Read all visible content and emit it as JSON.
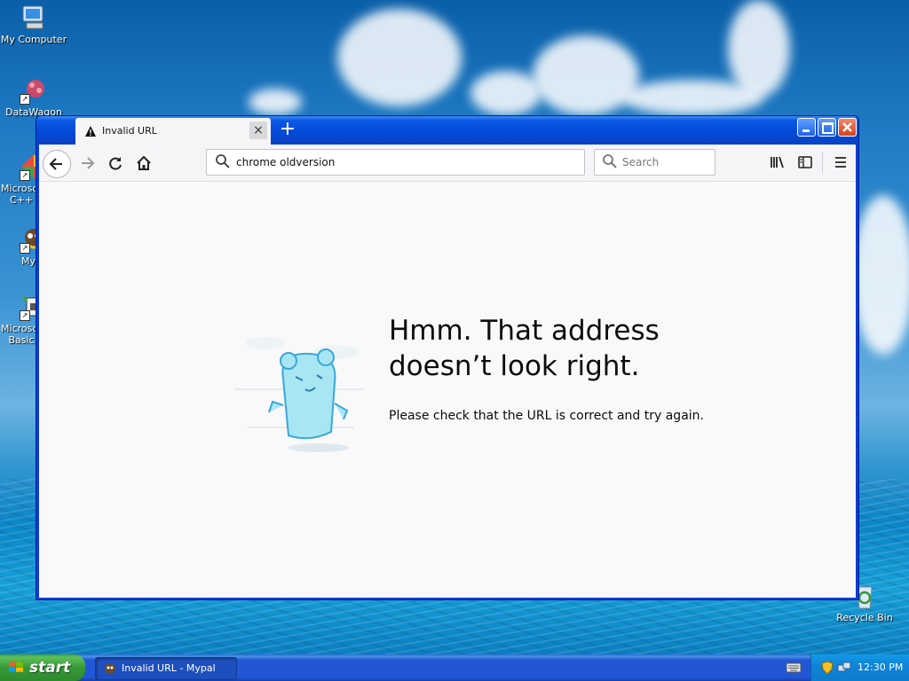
{
  "desktop": {
    "icons": [
      {
        "label": "My Computer"
      },
      {
        "label": "DataWagon"
      },
      {
        "label": "Microsof\nC++"
      },
      {
        "label": "My"
      },
      {
        "label": "Microsof\nBasic"
      },
      {
        "label": "Recycle Bin"
      }
    ]
  },
  "browser": {
    "tab": {
      "title": "Invalid URL",
      "close_glyph": "×"
    },
    "new_tab_glyph": "+",
    "url_value": "chrome oldversion",
    "search_placeholder": "Search",
    "error": {
      "title": "Hmm. That address doesn’t look right.",
      "message": "Please check that the URL is correct and try again."
    }
  },
  "taskbar": {
    "start_label": "start",
    "window_button": "Invalid URL - Mypal",
    "clock": "12:30 PM"
  }
}
